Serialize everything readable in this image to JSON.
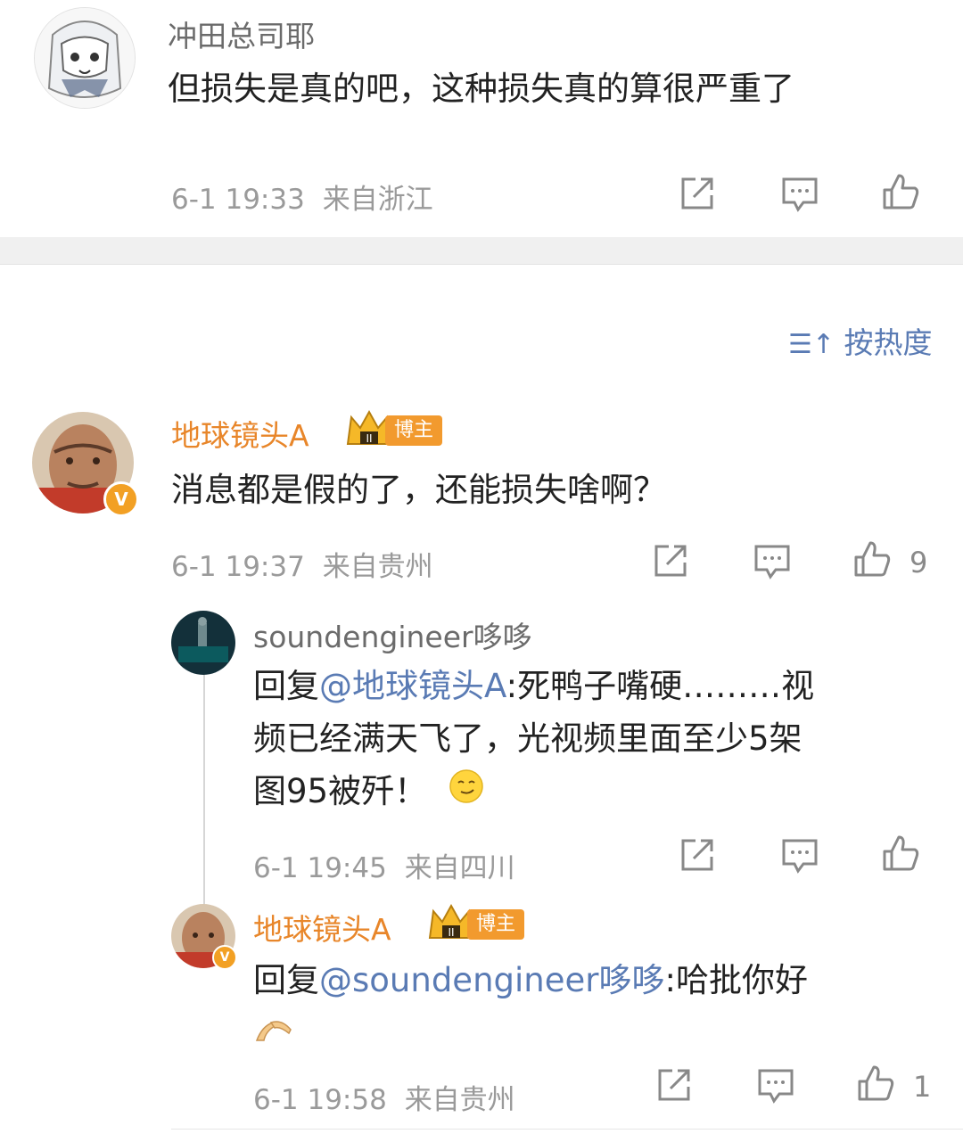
{
  "top_comment": {
    "user": "冲田总司耶",
    "text": "但损失是真的吧，这种损失真的算很严重了",
    "time": "6-1 19:33",
    "location": "来自浙江"
  },
  "sort": {
    "label": "按热度",
    "icon": "sort-icon"
  },
  "comment": {
    "user": "地球镜头A",
    "badge": "博主",
    "text": "消息都是假的了，还能损失啥啊？",
    "time": "6-1 19:37",
    "location": "来自贵州",
    "likes": "9"
  },
  "replies": [
    {
      "user": "soundengineer哆哆",
      "reply_prefix": "回复",
      "mention": "@地球镜头A",
      "text_line1": ":死鸭子嘴硬………视",
      "text_line2": "频已经满天飞了，光视频里面至少5架",
      "text_line3": "图95被歼！",
      "emoji": "smirk-emoji",
      "time": "6-1 19:45",
      "location": "来自四川"
    },
    {
      "user": "地球镜头A",
      "badge": "博主",
      "reply_prefix": "回复",
      "mention": "@soundengineer哆哆",
      "text_line1": ":哈批你好",
      "emoji": "pray-hands-emoji",
      "time": "6-1 19:58",
      "location": "来自贵州",
      "likes": "1"
    }
  ],
  "colors": {
    "accent_orange": "#e8862a",
    "link_blue": "#5a7bb4",
    "meta_gray": "#9a9a9a"
  }
}
